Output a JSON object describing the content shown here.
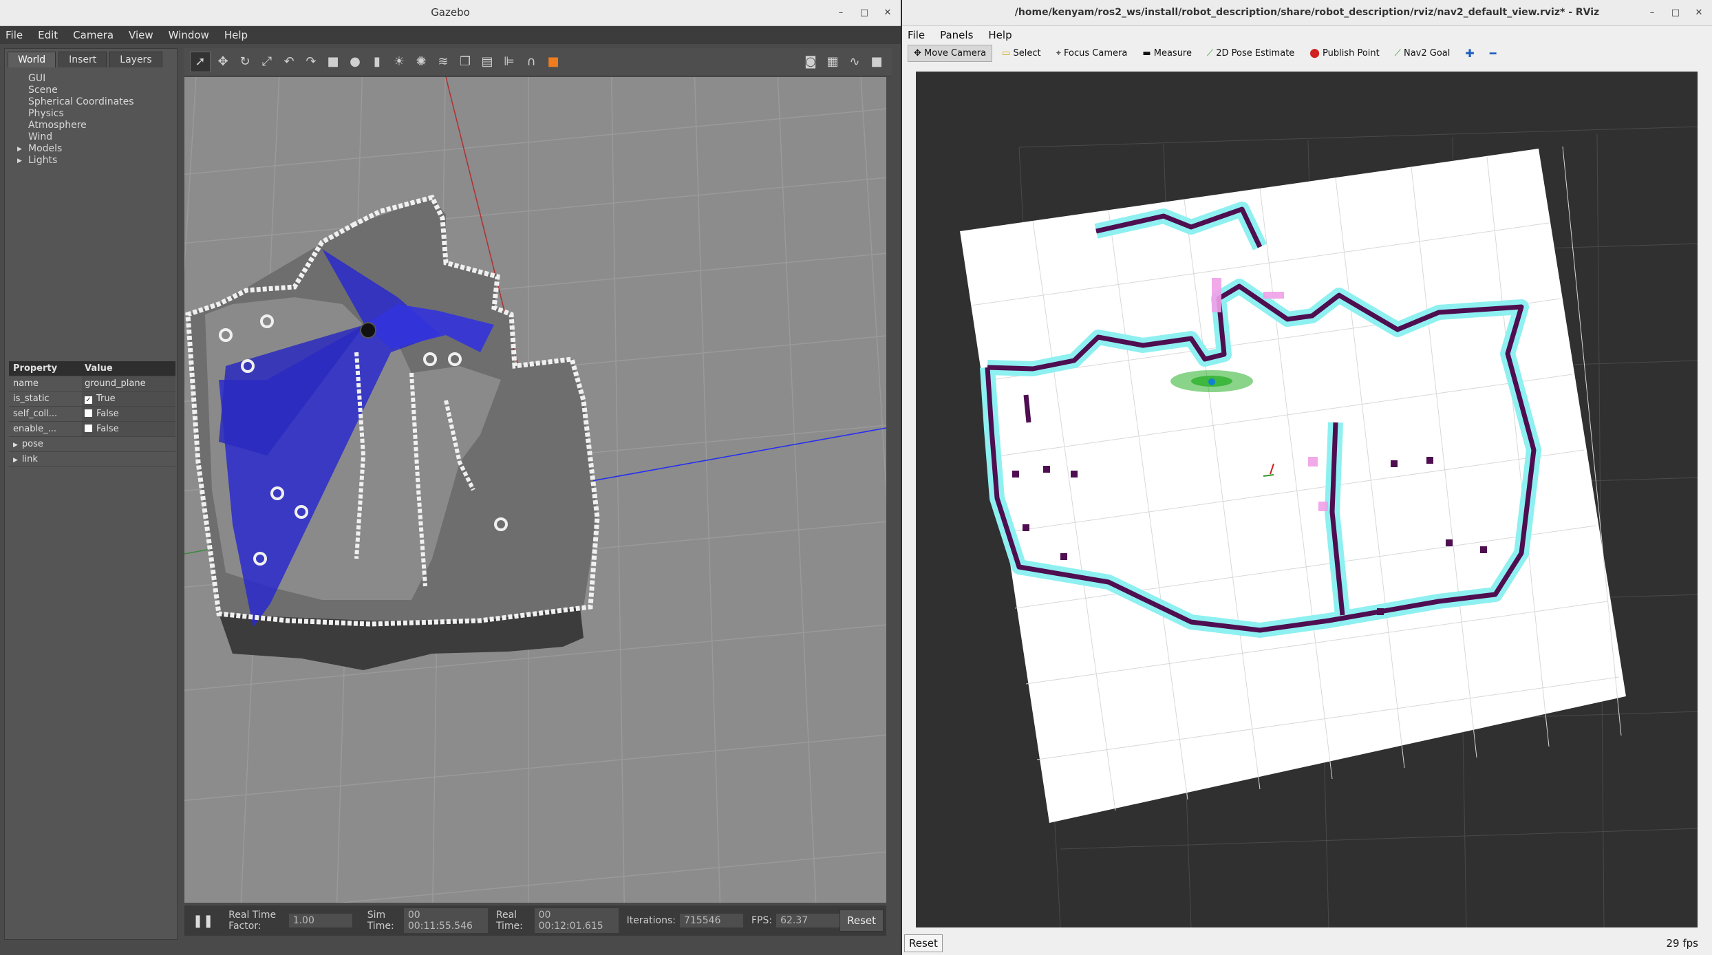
{
  "gazebo": {
    "title": "Gazebo",
    "menu": [
      "File",
      "Edit",
      "Camera",
      "View",
      "Window",
      "Help"
    ],
    "tabs": [
      "World",
      "Insert",
      "Layers"
    ],
    "tree": [
      "GUI",
      "Scene",
      "Spherical Coordinates",
      "Physics",
      "Atmosphere",
      "Wind",
      "Models",
      "Lights"
    ],
    "props_header": {
      "property": "Property",
      "value": "Value"
    },
    "props": {
      "name_key": "name",
      "name_val": "ground_plane",
      "static_key": "is_static",
      "static_val": "True",
      "self_key": "self_coll...",
      "self_val": "False",
      "enable_key": "enable_...",
      "enable_val": "False",
      "pose": "pose",
      "link": "link"
    },
    "status": {
      "rtf_label": "Real Time Factor:",
      "rtf": "1.00",
      "sim_label": "Sim Time:",
      "sim": "00 00:11:55.546",
      "real_label": "Real Time:",
      "real": "00 00:12:01.615",
      "iter_label": "Iterations:",
      "iter": "715546",
      "fps_label": "FPS:",
      "fps": "62.37",
      "reset": "Reset"
    }
  },
  "rviz": {
    "title": "/home/kenyam/ros2_ws/install/robot_description/share/robot_description/rviz/nav2_default_view.rviz* - RViz",
    "menu": [
      "File",
      "Panels",
      "Help"
    ],
    "tools": [
      "Move Camera",
      "Select",
      "Focus Camera",
      "Measure",
      "2D Pose Estimate",
      "Publish Point",
      "Nav2 Goal"
    ],
    "reset": "Reset",
    "fps": "29 fps"
  },
  "window_controls": {
    "min": "–",
    "max": "□",
    "close": "✕"
  }
}
